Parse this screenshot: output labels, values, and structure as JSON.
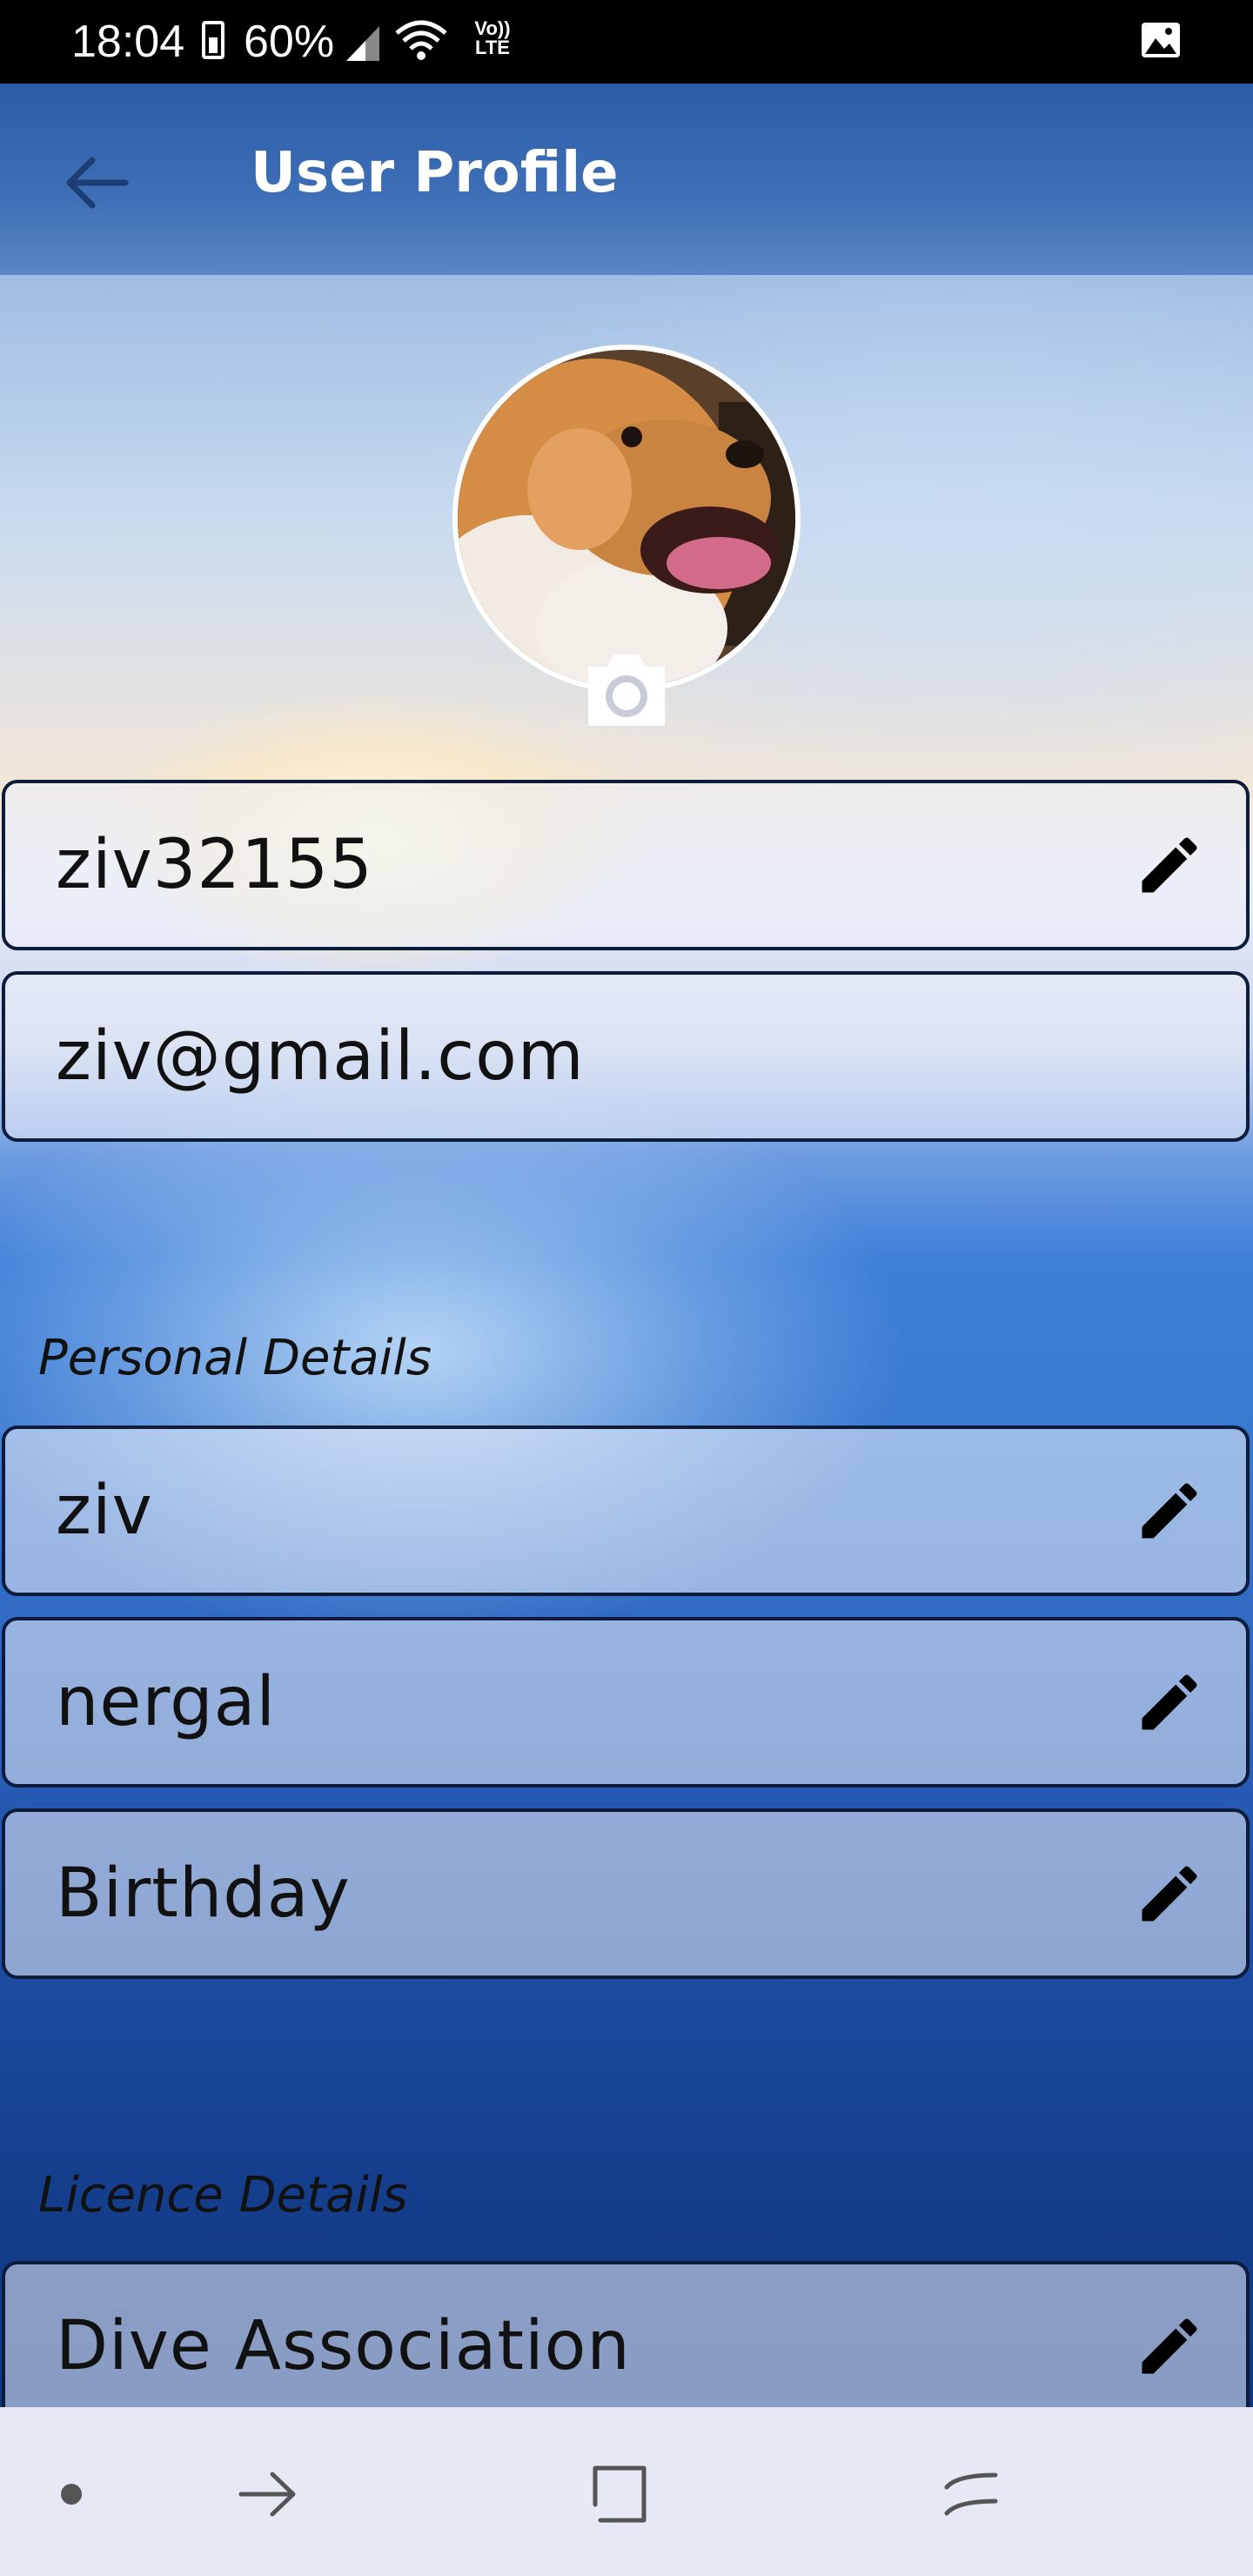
{
  "status_bar": {
    "time": "18:04",
    "battery": "60%",
    "network": "Vo)) LTE",
    "icons": [
      "battery-icon",
      "signal-icon",
      "wifi-icon",
      "gallery-icon"
    ]
  },
  "app_bar": {
    "title": "User Profile",
    "back_icon": "arrow-left-icon"
  },
  "profile": {
    "avatar_icon": "dog-photo-avatar",
    "camera_icon": "camera-icon"
  },
  "account": {
    "username": "ziv32155",
    "email": "ziv@gmail.com"
  },
  "personal": {
    "section_title": "Personal Details",
    "first_name": "ziv",
    "last_name": "nergal",
    "birthday": "Birthday"
  },
  "licence": {
    "section_title": "Licence Details",
    "dive_association": "Dive Association"
  },
  "nav_bar": {
    "icons": [
      "dot-icon",
      "arrow-right-icon",
      "recents-icon",
      "back-icon"
    ]
  },
  "colors": {
    "app_bar": "#2a5ca8",
    "field_border": "#0d1c3a",
    "nav_bar": "#e6e8f4"
  }
}
